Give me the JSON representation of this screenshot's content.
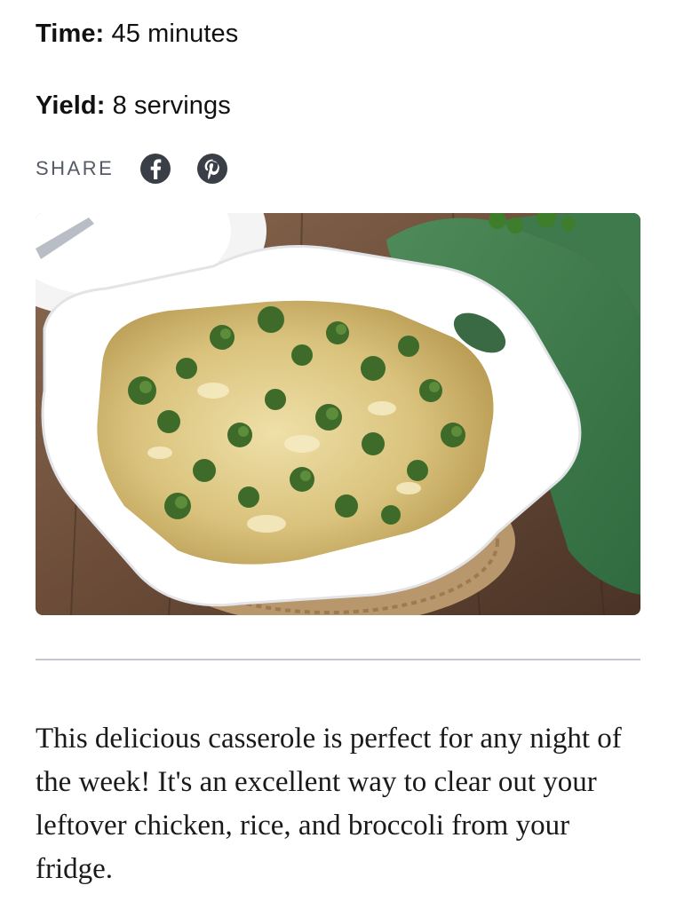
{
  "recipe": {
    "time_label": "Time:",
    "time_value": "45 minutes",
    "yield_label": "Yield:",
    "yield_value": "8 servings"
  },
  "share": {
    "label": "SHARE",
    "icons": [
      "facebook-icon",
      "pinterest-icon"
    ]
  },
  "hero_image": {
    "alt": "Broccoli chicken casserole in a white baking dish"
  },
  "description": "This delicious casserole is perfect for any night of the week! It's an excellent way to clear out your leftover chicken, rice, and broccoli from your fridge.",
  "colors": {
    "icon_fill": "#3a3f47",
    "divider": "#c4c7d0",
    "share_label": "#555b66"
  }
}
